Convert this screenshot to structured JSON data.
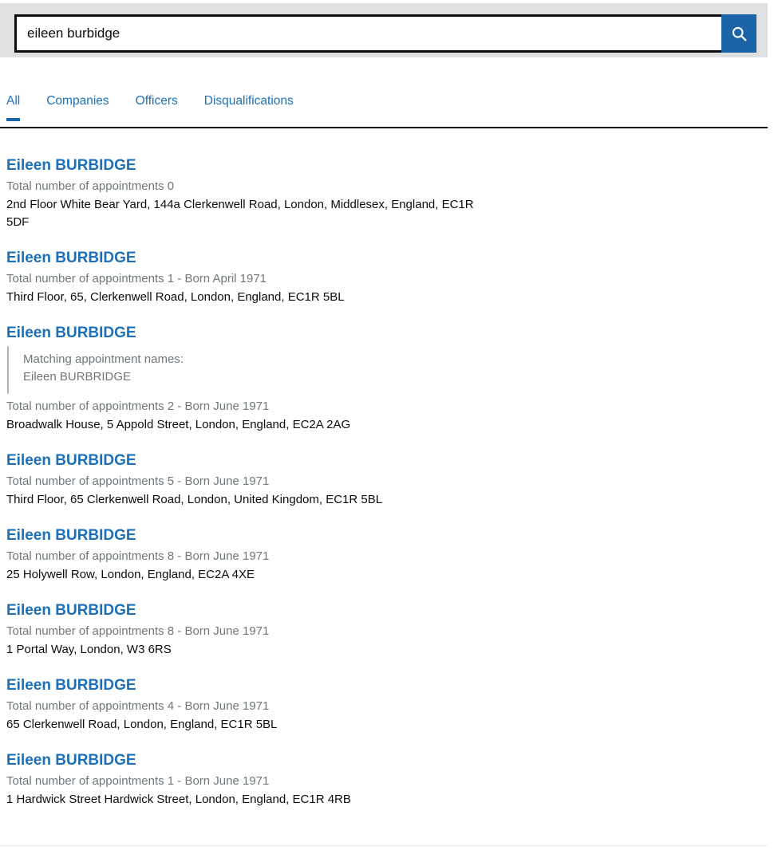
{
  "search": {
    "value": "eileen burbidge",
    "placeholder": "Search",
    "submit_label": "Search",
    "icon": "search-icon",
    "button_color": "#1b64a7",
    "band_color": "#dee0e2"
  },
  "tabs": {
    "items": [
      {
        "label": "All",
        "active": true
      },
      {
        "label": "Companies",
        "active": false
      },
      {
        "label": "Officers",
        "active": false
      },
      {
        "label": "Disqualifications",
        "active": false
      }
    ],
    "active_color": "#1b64a7",
    "link_color": "#1d70b8"
  },
  "results": [
    {
      "title": "Eileen BURBIDGE",
      "meta": "Total number of appointments 0",
      "address": "2nd Floor White Bear Yard, 144a Clerkenwell Road, London, Middlesex, England, EC1R 5DF",
      "matching": null
    },
    {
      "title": "Eileen BURBIDGE",
      "meta": "Total number of appointments 1 - Born April 1971",
      "address": "Third Floor, 65, Clerkenwell Road, London, England, EC1R 5BL",
      "matching": null
    },
    {
      "title": "Eileen BURBIDGE",
      "meta": "Total number of appointments 2 - Born June 1971",
      "address": "Broadwalk House, 5 Appold Street, London, England, EC2A 2AG",
      "matching": {
        "label": "Matching appointment names:",
        "name": "Eileen BURBRIDGE"
      }
    },
    {
      "title": "Eileen BURBIDGE",
      "meta": "Total number of appointments 5 - Born June 1971",
      "address": "Third Floor, 65 Clerkenwell Road, London, United Kingdom, EC1R 5BL",
      "matching": null
    },
    {
      "title": "Eileen BURBIDGE",
      "meta": "Total number of appointments 8 - Born June 1971",
      "address": "25 Holywell Row, London, England, EC2A 4XE",
      "matching": null
    },
    {
      "title": "Eileen BURBIDGE",
      "meta": "Total number of appointments 8 - Born June 1971",
      "address": "1 Portal Way, London, W3 6RS",
      "matching": null
    },
    {
      "title": "Eileen BURBIDGE",
      "meta": "Total number of appointments 4 - Born June 1971",
      "address": "65 Clerkenwell Road, London, England, EC1R 5BL",
      "matching": null
    },
    {
      "title": "Eileen BURBIDGE",
      "meta": "Total number of appointments 1 - Born June 1971",
      "address": "1 Hardwick Street Hardwick Street, London, England, EC1R 4RB",
      "matching": null
    }
  ]
}
